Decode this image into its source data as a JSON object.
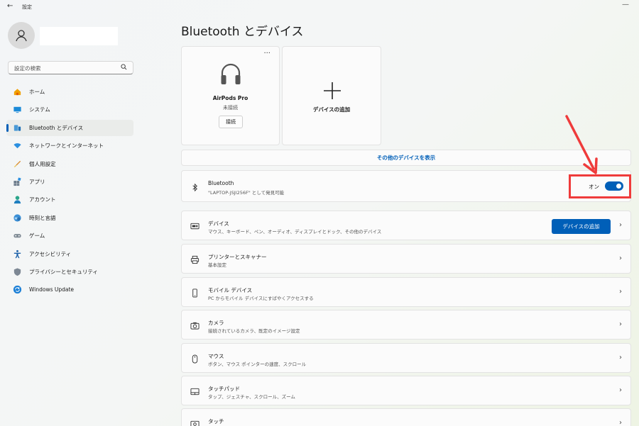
{
  "window": {
    "back_glyph": "←",
    "title": "設定",
    "minimize_glyph": "—"
  },
  "sidebar": {
    "search_placeholder": "設定の検索",
    "items": [
      {
        "label": "ホーム",
        "icon": "home-icon"
      },
      {
        "label": "システム",
        "icon": "system-icon"
      },
      {
        "label": "Bluetooth とデバイス",
        "icon": "bluetooth-devices-icon",
        "active": true
      },
      {
        "label": "ネットワークとインターネット",
        "icon": "network-icon"
      },
      {
        "label": "個人用設定",
        "icon": "personalization-icon"
      },
      {
        "label": "アプリ",
        "icon": "apps-icon"
      },
      {
        "label": "アカウント",
        "icon": "accounts-icon"
      },
      {
        "label": "時刻と言語",
        "icon": "time-language-icon"
      },
      {
        "label": "ゲーム",
        "icon": "gaming-icon"
      },
      {
        "label": "アクセシビリティ",
        "icon": "accessibility-icon"
      },
      {
        "label": "プライバシーとセキュリティ",
        "icon": "privacy-icon"
      },
      {
        "label": "Windows Update",
        "icon": "windows-update-icon"
      }
    ]
  },
  "main": {
    "title": "Bluetooth とデバイス",
    "device_card": {
      "name": "AirPods Pro",
      "status": "未接続",
      "connect_label": "接続",
      "more_glyph": "···"
    },
    "add_card": {
      "label": "デバイスの追加"
    },
    "more_devices": "その他のデバイスを表示",
    "bluetooth": {
      "title": "Bluetooth",
      "subtitle": "\"LAPTOP-JSJI256F\" として発見可能",
      "toggle_label": "オン",
      "toggle_on": true
    },
    "rows": [
      {
        "title": "デバイス",
        "subtitle": "マウス、キーボード、ペン、オーディオ、ディスプレイとドック、その他のデバイス",
        "icon": "devices-icon",
        "button": "デバイスの追加"
      },
      {
        "title": "プリンターとスキャナー",
        "subtitle": "基本設定",
        "icon": "printer-icon"
      },
      {
        "title": "モバイル デバイス",
        "subtitle": "PC からモバイル デバイスにすばやくアクセスする",
        "icon": "mobile-icon"
      },
      {
        "title": "カメラ",
        "subtitle": "接続されているカメラ、既定のイメージ設定",
        "icon": "camera-icon"
      },
      {
        "title": "マウス",
        "subtitle": "ボタン、マウス ポインターの速度、スクロール",
        "icon": "mouse-icon"
      },
      {
        "title": "タッチパッド",
        "subtitle": "タップ、ジェスチャ、スクロール、ズーム",
        "icon": "touchpad-icon"
      },
      {
        "title": "タッチ",
        "subtitle": "",
        "icon": "touch-icon"
      }
    ],
    "chevron_glyph": "›"
  },
  "colors": {
    "accent": "#005fb8",
    "highlight": "#ef3b3b"
  }
}
